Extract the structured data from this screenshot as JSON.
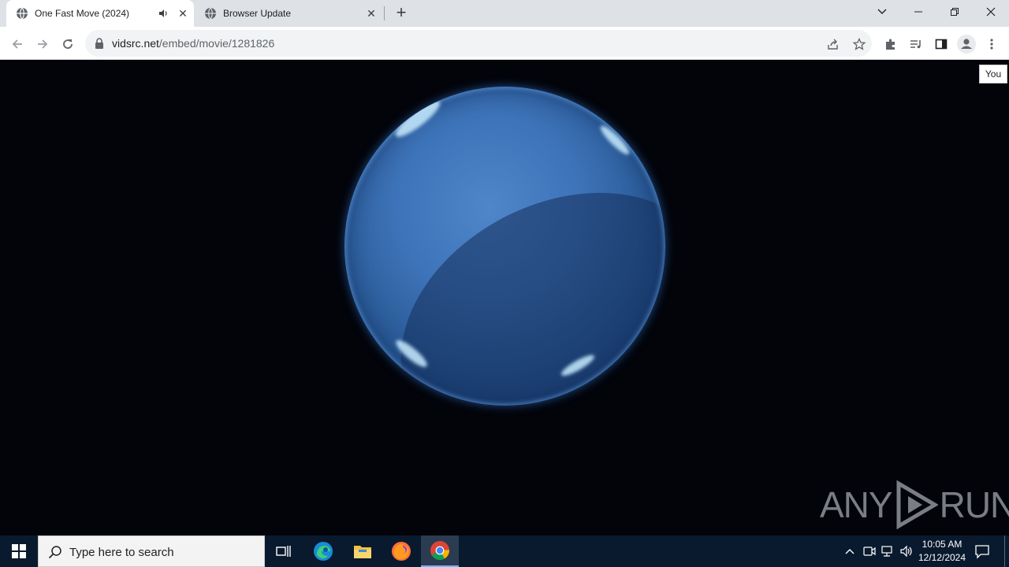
{
  "browser": {
    "tabs": [
      {
        "title": "One Fast Move (2024)",
        "active": true,
        "audio": true
      },
      {
        "title": "Browser Update",
        "active": false,
        "audio": false
      }
    ],
    "new_tab_label": "+",
    "address": {
      "host": "vidsrc.net",
      "path": "/embed/movie/1281826"
    },
    "profile_tooltip": "You"
  },
  "watermark": {
    "left": "ANY",
    "right": "RUN"
  },
  "taskbar": {
    "search_placeholder": "Type here to search",
    "apps": [
      "task-view",
      "edge",
      "file-explorer",
      "firefox",
      "chrome"
    ],
    "clock": {
      "time": "10:05 AM",
      "date": "12/12/2024"
    }
  },
  "colors": {
    "sphere": "#3d73b8",
    "tabstrip": "#dee1e6",
    "taskbar": "#0a1a2e"
  }
}
